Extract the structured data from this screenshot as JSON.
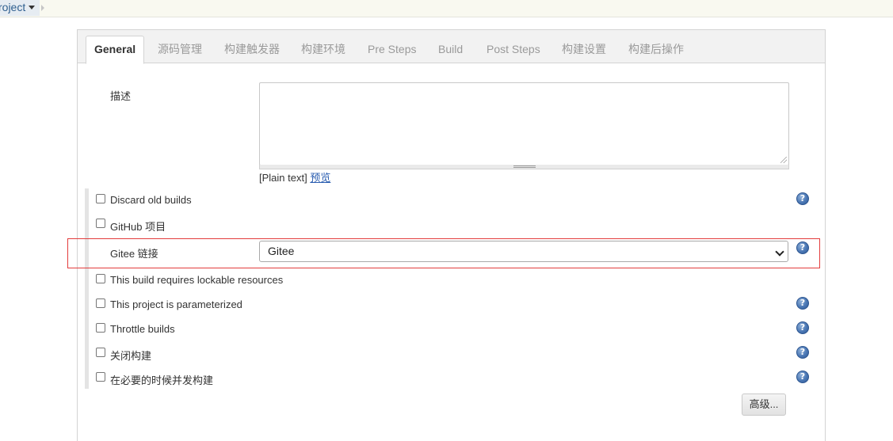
{
  "breadcrumb": {
    "project_label": "roject"
  },
  "tabs": [
    {
      "label": "General",
      "active": true
    },
    {
      "label": "源码管理"
    },
    {
      "label": "构建触发器"
    },
    {
      "label": "构建环境"
    },
    {
      "label": "Pre Steps"
    },
    {
      "label": "Build"
    },
    {
      "label": "Post Steps"
    },
    {
      "label": "构建设置"
    },
    {
      "label": "构建后操作"
    }
  ],
  "description": {
    "label": "描述",
    "value": "",
    "format_prefix": "[Plain text]",
    "preview_link": "预览"
  },
  "options": [
    {
      "label": "Discard old builds",
      "checked": false,
      "help": true
    },
    {
      "label": "GitHub 项目",
      "checked": false,
      "help": false
    },
    {
      "label": "This build requires lockable resources",
      "checked": false,
      "help": false
    },
    {
      "label": "This project is parameterized",
      "checked": false,
      "help": true
    },
    {
      "label": "Throttle builds",
      "checked": false,
      "help": true
    },
    {
      "label": "关闭构建",
      "checked": false,
      "help": true
    },
    {
      "label": "在必要的时候并发构建",
      "checked": false,
      "help": true
    }
  ],
  "gitee": {
    "label": "Gitee 链接",
    "selected": "Gitee",
    "highlight_color": "#e33c3c"
  },
  "advanced_button": "高级...",
  "help_glyph": "?",
  "icons": {
    "help": "help-circle-icon",
    "dropdown": "chevron-down-icon",
    "breadcrumb_caret": "caret-down-icon"
  }
}
